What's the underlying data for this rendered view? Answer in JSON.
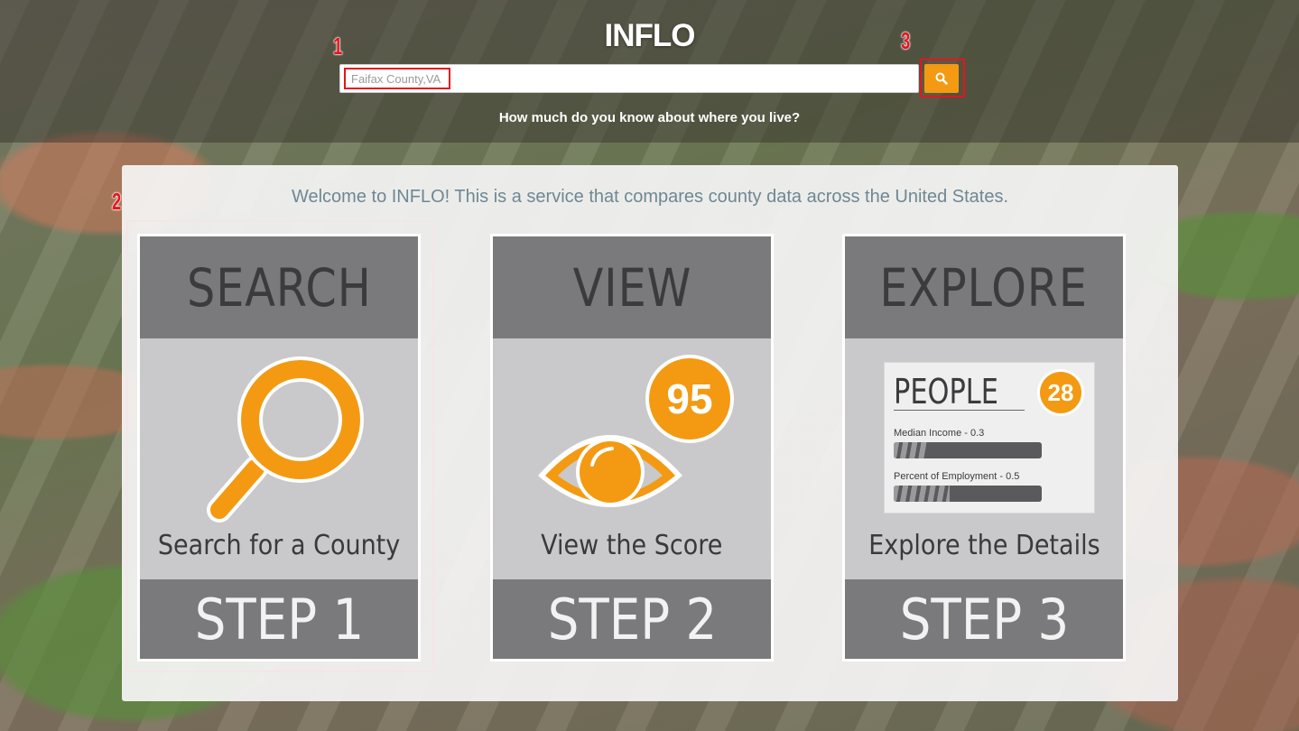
{
  "app": {
    "title": "INFLO"
  },
  "search": {
    "value": "Faifax County,VA",
    "placeholder": "Faifax County,VA",
    "button_icon": "search-icon"
  },
  "tagline": "How much do you know about where you live?",
  "welcome": "Welcome to INFLO! This is a service that compares county data across the United States.",
  "annotations": [
    "1",
    "2",
    "3"
  ],
  "annotation_color": "#e8141b",
  "accent_color": "#f39a12",
  "steps": [
    {
      "heading": "SEARCH",
      "caption": "Search for a County",
      "step": "STEP 1",
      "icon": "magnifier-icon"
    },
    {
      "heading": "VIEW",
      "caption": "View the Score",
      "step": "STEP 2",
      "icon": "eye-icon",
      "score": "95"
    },
    {
      "heading": "EXPLORE",
      "caption": "Explore the Details",
      "step": "STEP 3",
      "icon": "people-card-icon",
      "people": {
        "title": "PEOPLE",
        "score": "28",
        "metrics": [
          {
            "label": "Median Income - 0.3",
            "value": 0.3
          },
          {
            "label": "Percent of Employment - 0.5",
            "value": 0.5
          }
        ]
      }
    }
  ]
}
